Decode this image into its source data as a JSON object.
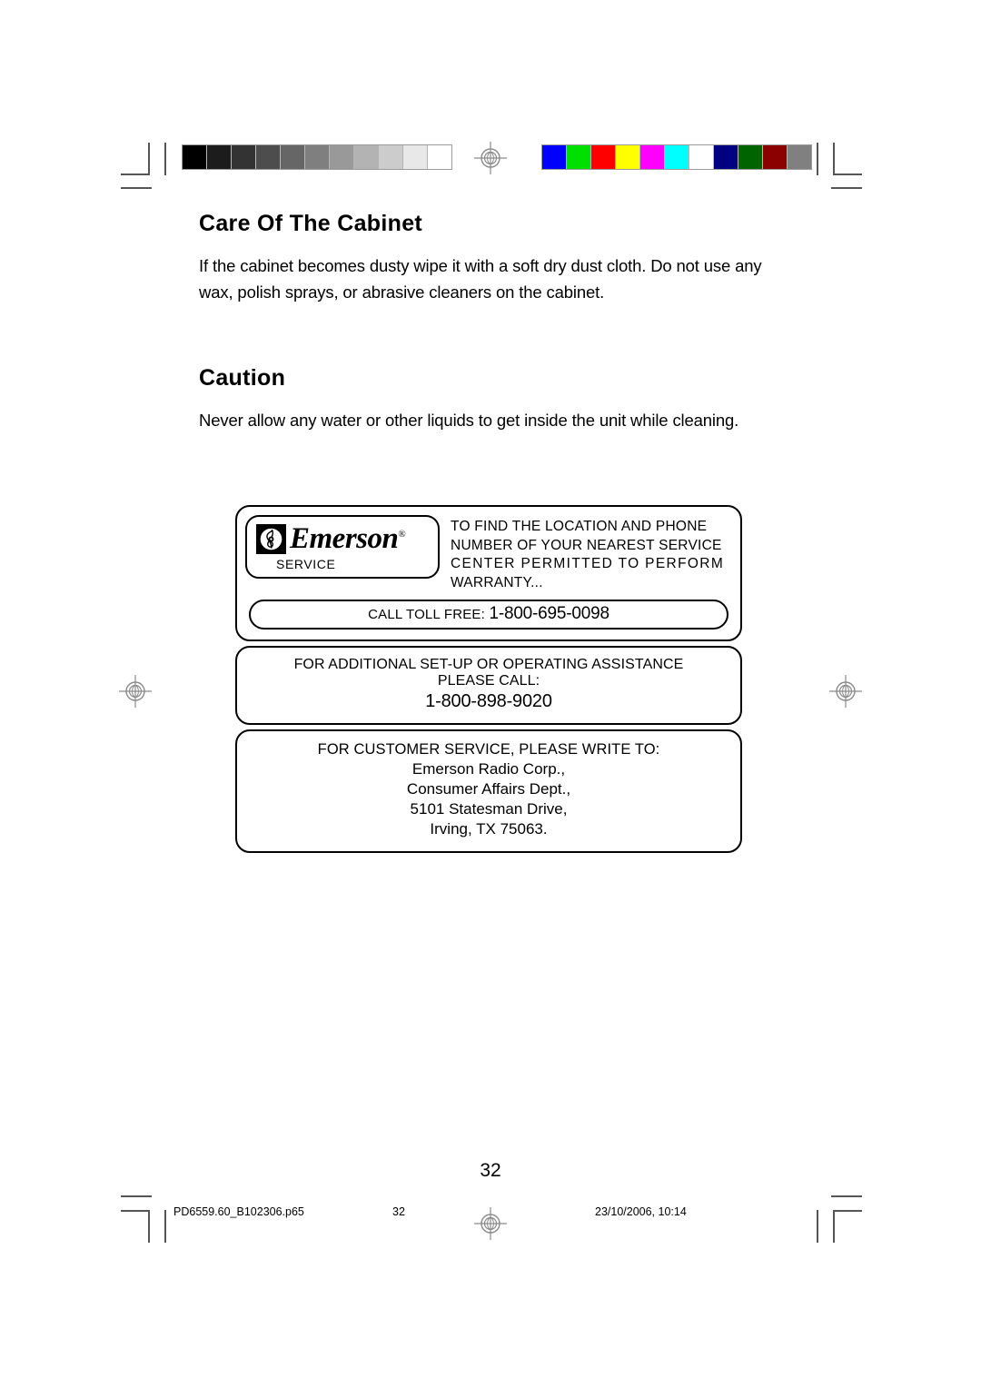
{
  "document": {
    "page_number": "32"
  },
  "calibration": {
    "gray_scale": [
      "#000000",
      "#1c1c1c",
      "#333333",
      "#4d4d4d",
      "#666666",
      "#7f7f7f",
      "#999999",
      "#b3b3b3",
      "#cccccc",
      "#e8e8e8",
      "#ffffff"
    ],
    "color_bars": [
      "#0000ff",
      "#00e000",
      "#ff0000",
      "#ffff00",
      "#ff00ff",
      "#00ffff",
      "#ffffff",
      "#000080",
      "#006400",
      "#8b0000",
      "#808080"
    ]
  },
  "sections": [
    {
      "id": "care-of-the-cabinet",
      "title": "Care Of The Cabinet",
      "body": "If the cabinet becomes dusty wipe it with a soft dry dust cloth.  Do not use any wax, polish sprays, or abrasive cleaners on the cabinet."
    },
    {
      "id": "caution",
      "title": "Caution",
      "body": "Never allow any water or other liquids to get inside the unit while cleaning."
    }
  ],
  "service_panel": {
    "logo": {
      "wordmark": "Emerson",
      "registered_symbol": "®",
      "subtitle": "SERVICE",
      "icon": "treble-clef-icon"
    },
    "warranty_lines": [
      "TO FIND THE LOCATION AND PHONE",
      "NUMBER OF YOUR NEAREST SERVICE",
      "CENTER PERMITTED TO PERFORM",
      "WARRANTY..."
    ],
    "toll_free": {
      "label": "CALL TOLL FREE:",
      "number": "1-800-695-0098"
    },
    "assistance": {
      "line1": "FOR ADDITIONAL SET-UP OR OPERATING ASSISTANCE",
      "line2": "PLEASE CALL:",
      "phone": "1-800-898-9020"
    },
    "customer_service": {
      "heading": "FOR CUSTOMER SERVICE, PLEASE WRITE TO:",
      "address": [
        "Emerson Radio Corp.,",
        "Consumer Affairs Dept.,",
        "5101 Statesman Drive,",
        "Irving, TX 75063."
      ]
    }
  },
  "footer": {
    "file_name": "PD6559.60_B102306.p65",
    "page": "32",
    "timestamp": "23/10/2006, 10:14"
  }
}
